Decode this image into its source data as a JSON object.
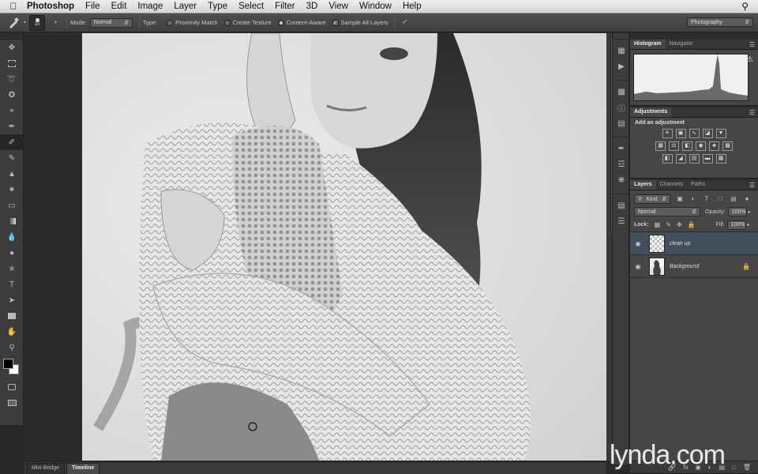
{
  "menubar": {
    "apple": "",
    "app": "Photoshop",
    "items": [
      "File",
      "Edit",
      "Image",
      "Layer",
      "Type",
      "Select",
      "Filter",
      "3D",
      "View",
      "Window",
      "Help"
    ]
  },
  "options": {
    "brush_size": "15",
    "mode_label": "Mode:",
    "mode_value": "Normal",
    "type_label": "Type:",
    "type_options": [
      "Proximity Match",
      "Create Texture",
      "Content-Aware"
    ],
    "type_selected": "Content-Aware",
    "sample_all_layers": "Sample All Layers",
    "sample_all_checked": true,
    "workspace": "Photography"
  },
  "bottom_tabs": [
    "Mini Bridge",
    "Timeline"
  ],
  "active_bottom_tab": "Timeline",
  "histogram_panel": {
    "tabs": [
      "Histogram",
      "Navigator"
    ]
  },
  "adjustments_panel": {
    "tab": "Adjustments",
    "title": "Add an adjustment"
  },
  "layers_panel": {
    "tabs": [
      "Layers",
      "Channels",
      "Paths"
    ],
    "filter_kind": "Kind",
    "blend_mode": "Normal",
    "opacity_label": "Opacity:",
    "opacity_value": "100%",
    "lock_label": "Lock:",
    "fill_label": "Fill:",
    "fill_value": "100%",
    "layers": [
      {
        "name": "clean up",
        "selected": true
      },
      {
        "name": "Background",
        "selected": false,
        "locked": true
      }
    ]
  },
  "watermark": {
    "brand": "lynda",
    "suffix": ".com"
  },
  "colors": {
    "foreground": "#000000",
    "background": "#ffffff",
    "selection": "#42505e"
  }
}
